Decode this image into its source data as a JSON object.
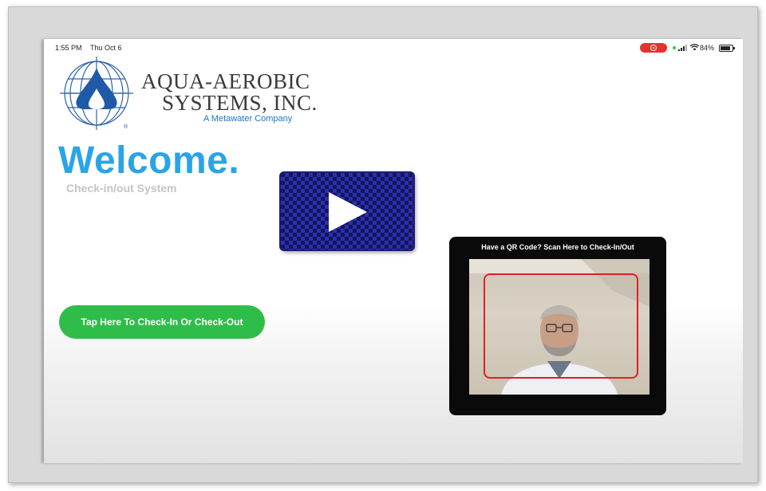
{
  "status_bar": {
    "time": "1:55 PM",
    "date": "Thu Oct 6",
    "battery_percent": "84%",
    "battery_level": 0.84
  },
  "brand": {
    "name_line1": "AQUA-AEROBIC",
    "name_line2": "SYSTEMS, INC.",
    "tagline": "A Metawater Company",
    "registered_mark": "®",
    "colors": {
      "primary_blue": "#1f73c9",
      "welcome_blue": "#2ba4e6",
      "button_green": "#2fbd4a",
      "scan_red": "#e02020"
    }
  },
  "welcome": {
    "title": "Welcome.",
    "subtitle": "Check-in/out System"
  },
  "actions": {
    "checkin_button_label": "Tap Here To Check-In Or Check-Out"
  },
  "scanner": {
    "title": "Have a QR Code? Scan Here to Check-In/Out"
  },
  "overlay": {
    "icon": "play-icon"
  }
}
